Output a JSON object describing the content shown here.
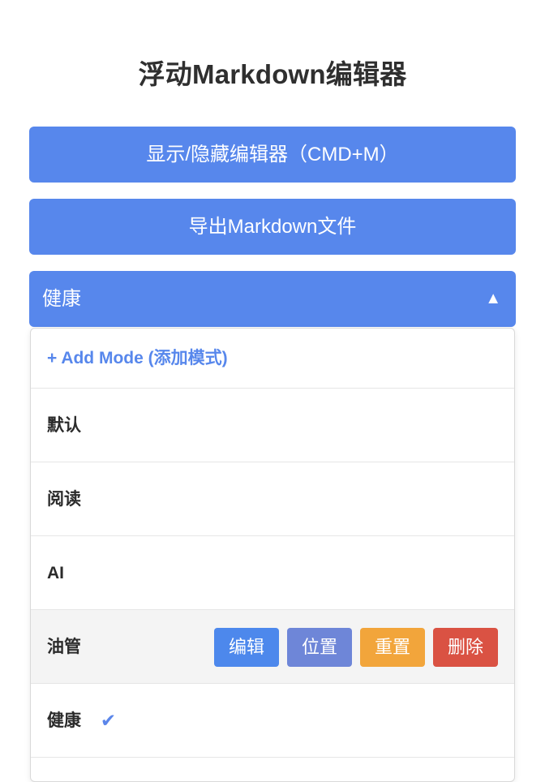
{
  "app": {
    "title": "浮动Markdown编辑器"
  },
  "buttons": {
    "toggle_label": "显示/隐藏编辑器（CMD+M）",
    "export_label": "导出Markdown文件"
  },
  "mode_select": {
    "selected": "健康",
    "arrow_icon": "▲"
  },
  "dropdown": {
    "add_mode_label": "+ Add Mode (添加模式)",
    "items": [
      {
        "label": "默认"
      },
      {
        "label": "阅读"
      },
      {
        "label": "AI"
      },
      {
        "label": "油管"
      },
      {
        "label": "健康"
      }
    ],
    "check_icon": "✔",
    "actions": {
      "edit": "编辑",
      "position": "位置",
      "reset": "重置",
      "delete": "删除"
    }
  },
  "colors": {
    "primary": "#5787ec",
    "edit": "#4d88ec",
    "position": "#6e86d8",
    "reset": "#f2a53b",
    "delete": "#da5243",
    "hover_row": "#f4f4f4"
  }
}
